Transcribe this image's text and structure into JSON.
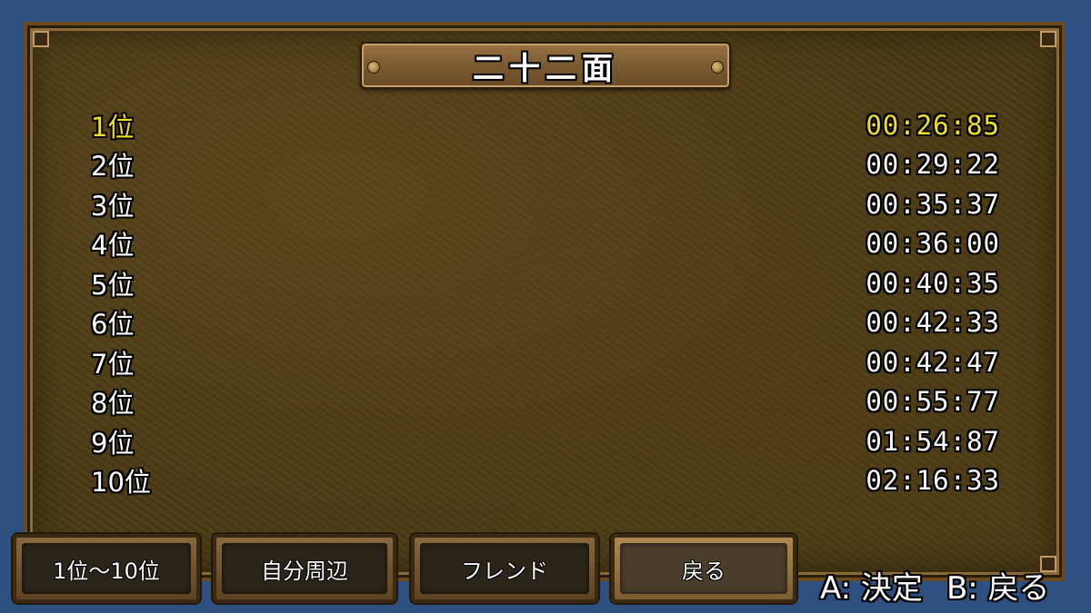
{
  "title": "二十二面",
  "rankings": [
    {
      "rank": "1位",
      "time": "00:26:85",
      "highlight": true
    },
    {
      "rank": "2位",
      "time": "00:29:22"
    },
    {
      "rank": "3位",
      "time": "00:35:37"
    },
    {
      "rank": "4位",
      "time": "00:36:00"
    },
    {
      "rank": "5位",
      "time": "00:40:35"
    },
    {
      "rank": "6位",
      "time": "00:42:33"
    },
    {
      "rank": "7位",
      "time": "00:42:47"
    },
    {
      "rank": "8位",
      "time": "00:55:77"
    },
    {
      "rank": "9位",
      "time": "01:54:87"
    },
    {
      "rank": "10位",
      "time": "02:16:33"
    }
  ],
  "tabs": [
    {
      "label": "1位～10位"
    },
    {
      "label": "自分周辺"
    },
    {
      "label": "フレンド"
    },
    {
      "label": "戻る",
      "active": true
    }
  ],
  "hints": {
    "confirm": "A: 決定",
    "back": "B: 戻る"
  },
  "colors": {
    "background": "#2e5080",
    "panel": "#4a3a14",
    "highlight": "#f0e020",
    "text": "#ffffff"
  }
}
